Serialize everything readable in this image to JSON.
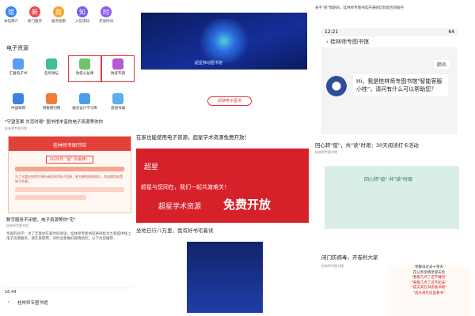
{
  "col1": {
    "apps": [
      {
        "label": "本馆简介",
        "color": "#3b82f6",
        "glyph": "馆"
      },
      {
        "label": "新门服务",
        "color": "#f04b4b",
        "glyph": "新"
      },
      {
        "label": "服务指南",
        "color": "#f5a623",
        "glyph": "南"
      },
      {
        "label": "入馆须知",
        "color": "#7c5cf0",
        "glyph": "知"
      },
      {
        "label": "开放时间",
        "color": "#8b5cf6",
        "glyph": "时"
      }
    ],
    "section_title": "电子资源",
    "tiles": [
      {
        "label": "汇雅电子书",
        "color": "#5b9cf5"
      },
      {
        "label": "名师讲坛",
        "color": "#3fbf8f"
      },
      {
        "label": "防疫公益课",
        "color": "#6cc36c",
        "highlight": true
      },
      {
        "label": "防疫专题",
        "color": "#b45bd6",
        "highlight": true
      },
      {
        "label": "中国知网",
        "color": "#3c82e0"
      },
      {
        "label": "博看期刊网",
        "color": "#f07c3a"
      },
      {
        "label": "展览设计学习库",
        "color": "#4a9de8"
      },
      {
        "label": "悠悠书城",
        "color": "#5ab0ea"
      }
    ],
    "article_title": "\"守望答案 共克时艰\" 图书馆丰富的电子资源等你你",
    "article_meta": "桂林师专图书馆",
    "poster_bar": "桂林师专图书馆",
    "poster_header": "2020年 \"鼠\" 你最棒！",
    "poster_text": "为了丰富在校师生课外阅读利用电子资源，更方便地获取知识，欢迎使用本馆电子资源。",
    "article2_title": "数字服务不闭馆，电子资源等你\"宅\"",
    "article2_meta": "桂林师专图书馆",
    "paragraph": "亲爱的同学：为了丰富你在家时的阅读，桂林师专图书馆将持续为大家提供线上电子资源服务，请在家使用，同时注意做好疫情防控。以下为您推荐：",
    "phone_time": "16:44",
    "phone_title": "桂林师专图书馆"
  },
  "col2": {
    "hero_caption": "超星移动图书馆",
    "button_label": "阅读电子图书",
    "caption": "在家也能使用电子资源，超星学术资源免费开放！",
    "banner_logo": "超星",
    "banner_line1": "超星与您同在，我们一起共渡难关！",
    "banner_line2": "超星学术资源",
    "banner_line3": "免费开放",
    "caption_bottom": "坐地日行八万里，我有好书宅着读"
  },
  "col3": {
    "top_title": "关于\"疫\"情期间，桂林师专图书馆开通微信智能咨询服务",
    "status_time": "12:21",
    "status_right": "64",
    "nav_title": "桂林师专图书馆",
    "tag": "肺炎",
    "bubble": "Hi，我是桂林师专图书馆\"智能客服小桂\"，请问有什么可以帮助您？",
    "title2": "回心转\"疫\"，共\"读\"时艰：30天阅读打卡活动",
    "meta2": "桂林师专图书馆",
    "banner_text": "回心转\"疫\"·共\"读\"时艰",
    "title3": "闭门防病毒，开卷利大家",
    "meta3": "桂林师专图书馆",
    "poem": [
      "举群日过去十余天",
      "在父亲亲情享受天伦",
      "\"看看几点了还不睡觉\"",
      "\"看看几点了还不起床\"",
      "\"成天窝在书房看书呢\"",
      "\"成天窝在房里看书\""
    ]
  }
}
